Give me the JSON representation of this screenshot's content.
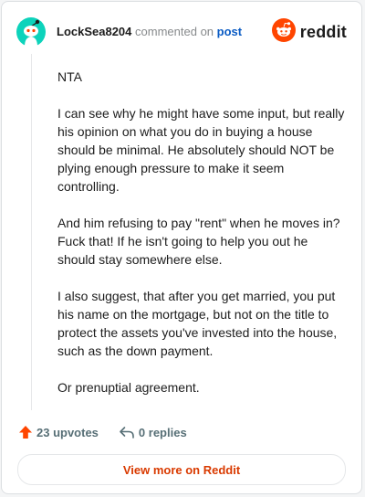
{
  "comment": {
    "username": "LockSea8204",
    "action_text": "commented on",
    "post_link_text": "post",
    "brand": "reddit",
    "paragraphs": [
      "NTA",
      "I can see why he might have some input, but really his opinion on what you do in buying a house should be minimal. He absolutely should NOT be plying enough pressure to make it seem controlling.",
      "And him refusing to pay \"rent\" when he moves in? Fuck that! If he isn't going to help you out he should stay somewhere else.",
      "I also suggest, that after you get married, you put his name on the mortgage, but not on the title to protect the assets you've invested into the house, such as the down payment.",
      "Or prenuptial agreement."
    ]
  },
  "footer": {
    "upvotes_label": "23 upvotes",
    "replies_label": "0 replies"
  },
  "cta": {
    "label": "View more on Reddit"
  },
  "colors": {
    "reddit_orange": "#ff4500",
    "cta_text": "#d93a00",
    "avatar_bg": "#0dd3bb",
    "link": "#0a5bc4"
  },
  "icons": {
    "avatar": "snoo-avatar-icon",
    "brand_logo": "reddit-logo-icon",
    "upvote": "upvote-arrow-icon",
    "reply": "reply-arrow-icon"
  }
}
